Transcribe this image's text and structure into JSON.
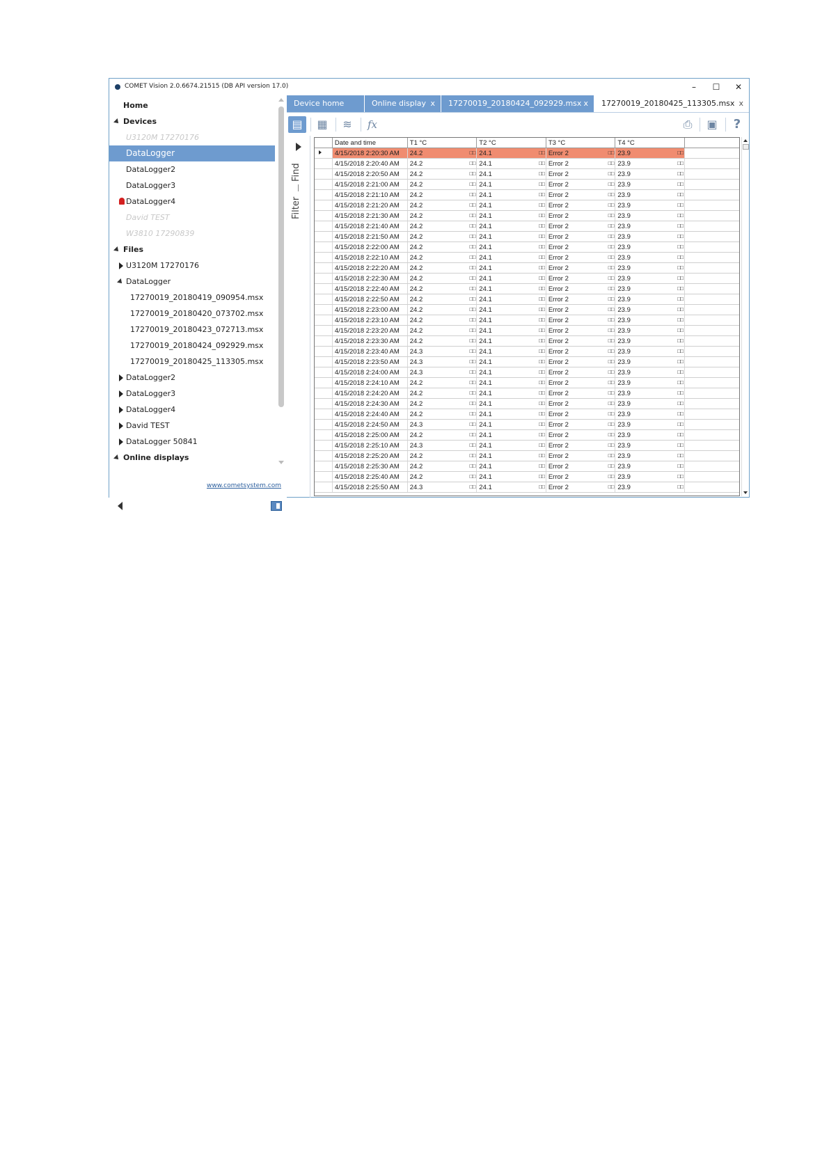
{
  "window": {
    "title": "COMET Vision 2.0.6674.21515 (DB API version 17.0)",
    "controls": {
      "minimize": "–",
      "maximize": "☐",
      "close": "✕"
    }
  },
  "sidebar": {
    "items": [
      {
        "label": "Home",
        "kind": "section"
      },
      {
        "label": "Devices",
        "kind": "section"
      },
      {
        "label": "U3120M 17270176",
        "kind": "disabled"
      },
      {
        "label": "DataLogger",
        "kind": "selected"
      },
      {
        "label": "DataLogger2",
        "kind": "device"
      },
      {
        "label": "DataLogger3",
        "kind": "device"
      },
      {
        "label": "DataLogger4",
        "kind": "alarm"
      },
      {
        "label": "David TEST",
        "kind": "disabled"
      },
      {
        "label": "W3810 17290839",
        "kind": "disabled"
      },
      {
        "label": "Files",
        "kind": "section"
      },
      {
        "label": "U3120M 17270176",
        "kind": "folder"
      },
      {
        "label": "DataLogger",
        "kind": "folder-open"
      },
      {
        "label": "17270019_20180419_090954.msx",
        "kind": "file"
      },
      {
        "label": "17270019_20180420_073702.msx",
        "kind": "file"
      },
      {
        "label": "17270019_20180423_072713.msx",
        "kind": "file"
      },
      {
        "label": "17270019_20180424_092929.msx",
        "kind": "file"
      },
      {
        "label": "17270019_20180425_113305.msx",
        "kind": "file"
      },
      {
        "label": "DataLogger2",
        "kind": "folder"
      },
      {
        "label": "DataLogger3",
        "kind": "folder"
      },
      {
        "label": "DataLogger4",
        "kind": "folder"
      },
      {
        "label": "David TEST",
        "kind": "folder"
      },
      {
        "label": "DataLogger 50841",
        "kind": "folder"
      },
      {
        "label": "Online displays",
        "kind": "section"
      }
    ],
    "link": "www.cometsystem.com"
  },
  "tabs": [
    {
      "label": "Device home",
      "closable": false,
      "active": false
    },
    {
      "label": "Online display",
      "closable": true,
      "active": false
    },
    {
      "label": "17270019_20180424_092929.msx",
      "closable": true,
      "active": false
    },
    {
      "label": "17270019_20180425_113305.msx",
      "closable": true,
      "active": true
    }
  ],
  "tab_close": "x",
  "side_panel": {
    "find": "Find",
    "filter": "Filter"
  },
  "toolbar": {
    "fx": "fx"
  },
  "icons": {
    "table": "table-icon",
    "graph": "graph-icon",
    "series": "series-icon",
    "function": "function-icon",
    "print": "print-icon",
    "export": "export-icon",
    "help": "help-icon"
  },
  "colors": {
    "accent": "#6e9bcf",
    "selected_row": "#f08c70"
  },
  "grid": {
    "columns": [
      "Date and time",
      "T1 °C",
      "T2 °C",
      "T3 °C",
      "T4 °C"
    ],
    "flag": "□□",
    "rows": [
      [
        "4/15/2018 2:20:30 AM",
        "24.2",
        "24.1",
        "Error 2",
        "23.9"
      ],
      [
        "4/15/2018 2:20:40 AM",
        "24.2",
        "24.1",
        "Error 2",
        "23.9"
      ],
      [
        "4/15/2018 2:20:50 AM",
        "24.2",
        "24.1",
        "Error 2",
        "23.9"
      ],
      [
        "4/15/2018 2:21:00 AM",
        "24.2",
        "24.1",
        "Error 2",
        "23.9"
      ],
      [
        "4/15/2018 2:21:10 AM",
        "24.2",
        "24.1",
        "Error 2",
        "23.9"
      ],
      [
        "4/15/2018 2:21:20 AM",
        "24.2",
        "24.1",
        "Error 2",
        "23.9"
      ],
      [
        "4/15/2018 2:21:30 AM",
        "24.2",
        "24.1",
        "Error 2",
        "23.9"
      ],
      [
        "4/15/2018 2:21:40 AM",
        "24.2",
        "24.1",
        "Error 2",
        "23.9"
      ],
      [
        "4/15/2018 2:21:50 AM",
        "24.2",
        "24.1",
        "Error 2",
        "23.9"
      ],
      [
        "4/15/2018 2:22:00 AM",
        "24.2",
        "24.1",
        "Error 2",
        "23.9"
      ],
      [
        "4/15/2018 2:22:10 AM",
        "24.2",
        "24.1",
        "Error 2",
        "23.9"
      ],
      [
        "4/15/2018 2:22:20 AM",
        "24.2",
        "24.1",
        "Error 2",
        "23.9"
      ],
      [
        "4/15/2018 2:22:30 AM",
        "24.2",
        "24.1",
        "Error 2",
        "23.9"
      ],
      [
        "4/15/2018 2:22:40 AM",
        "24.2",
        "24.1",
        "Error 2",
        "23.9"
      ],
      [
        "4/15/2018 2:22:50 AM",
        "24.2",
        "24.1",
        "Error 2",
        "23.9"
      ],
      [
        "4/15/2018 2:23:00 AM",
        "24.2",
        "24.1",
        "Error 2",
        "23.9"
      ],
      [
        "4/15/2018 2:23:10 AM",
        "24.2",
        "24.1",
        "Error 2",
        "23.9"
      ],
      [
        "4/15/2018 2:23:20 AM",
        "24.2",
        "24.1",
        "Error 2",
        "23.9"
      ],
      [
        "4/15/2018 2:23:30 AM",
        "24.2",
        "24.1",
        "Error 2",
        "23.9"
      ],
      [
        "4/15/2018 2:23:40 AM",
        "24.3",
        "24.1",
        "Error 2",
        "23.9"
      ],
      [
        "4/15/2018 2:23:50 AM",
        "24.3",
        "24.1",
        "Error 2",
        "23.9"
      ],
      [
        "4/15/2018 2:24:00 AM",
        "24.3",
        "24.1",
        "Error 2",
        "23.9"
      ],
      [
        "4/15/2018 2:24:10 AM",
        "24.2",
        "24.1",
        "Error 2",
        "23.9"
      ],
      [
        "4/15/2018 2:24:20 AM",
        "24.2",
        "24.1",
        "Error 2",
        "23.9"
      ],
      [
        "4/15/2018 2:24:30 AM",
        "24.2",
        "24.1",
        "Error 2",
        "23.9"
      ],
      [
        "4/15/2018 2:24:40 AM",
        "24.2",
        "24.1",
        "Error 2",
        "23.9"
      ],
      [
        "4/15/2018 2:24:50 AM",
        "24.3",
        "24.1",
        "Error 2",
        "23.9"
      ],
      [
        "4/15/2018 2:25:00 AM",
        "24.2",
        "24.1",
        "Error 2",
        "23.9"
      ],
      [
        "4/15/2018 2:25:10 AM",
        "24.3",
        "24.1",
        "Error 2",
        "23.9"
      ],
      [
        "4/15/2018 2:25:20 AM",
        "24.2",
        "24.1",
        "Error 2",
        "23.9"
      ],
      [
        "4/15/2018 2:25:30 AM",
        "24.2",
        "24.1",
        "Error 2",
        "23.9"
      ],
      [
        "4/15/2018 2:25:40 AM",
        "24.2",
        "24.1",
        "Error 2",
        "23.9"
      ],
      [
        "4/15/2018 2:25:50 AM",
        "24.3",
        "24.1",
        "Error 2",
        "23.9"
      ]
    ]
  }
}
